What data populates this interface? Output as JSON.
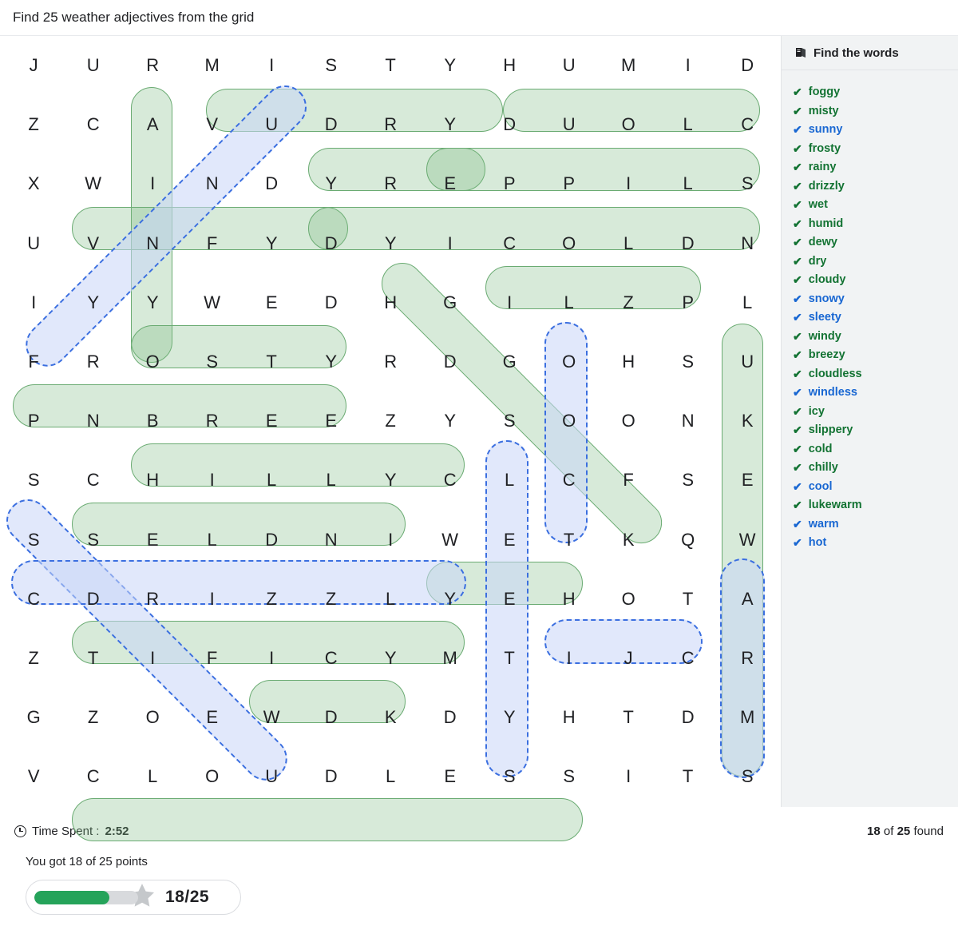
{
  "title": "Find 25 weather adjectives from the grid",
  "grid": {
    "rows": 13,
    "cols": 13,
    "letters": [
      [
        "J",
        "U",
        "R",
        "M",
        "I",
        "S",
        "T",
        "Y",
        "H",
        "U",
        "M",
        "I",
        "D"
      ],
      [
        "Z",
        "C",
        "A",
        "V",
        "U",
        "D",
        "R",
        "Y",
        "D",
        "U",
        "O",
        "L",
        "C"
      ],
      [
        "X",
        "W",
        "I",
        "N",
        "D",
        "Y",
        "R",
        "E",
        "P",
        "P",
        "I",
        "L",
        "S"
      ],
      [
        "U",
        "V",
        "N",
        "F",
        "Y",
        "D",
        "Y",
        "I",
        "C",
        "O",
        "L",
        "D",
        "N"
      ],
      [
        "I",
        "Y",
        "Y",
        "W",
        "E",
        "D",
        "H",
        "G",
        "I",
        "L",
        "Z",
        "P",
        "L"
      ],
      [
        "F",
        "R",
        "O",
        "S",
        "T",
        "Y",
        "R",
        "D",
        "G",
        "O",
        "H",
        "S",
        "U"
      ],
      [
        "P",
        "N",
        "B",
        "R",
        "E",
        "E",
        "Z",
        "Y",
        "S",
        "O",
        "O",
        "N",
        "K"
      ],
      [
        "S",
        "C",
        "H",
        "I",
        "L",
        "L",
        "Y",
        "C",
        "L",
        "C",
        "F",
        "S",
        "E"
      ],
      [
        "S",
        "S",
        "E",
        "L",
        "D",
        "N",
        "I",
        "W",
        "E",
        "T",
        "K",
        "Q",
        "W"
      ],
      [
        "C",
        "D",
        "R",
        "I",
        "Z",
        "Z",
        "L",
        "Y",
        "E",
        "H",
        "O",
        "T",
        "A"
      ],
      [
        "Z",
        "T",
        "I",
        "F",
        "I",
        "C",
        "Y",
        "M",
        "T",
        "I",
        "J",
        "C",
        "R"
      ],
      [
        "G",
        "Z",
        "O",
        "E",
        "W",
        "D",
        "K",
        "D",
        "Y",
        "H",
        "T",
        "D",
        "M"
      ],
      [
        "V",
        "C",
        "L",
        "O",
        "U",
        "D",
        "L",
        "E",
        "S",
        "S",
        "I",
        "T",
        "S"
      ]
    ]
  },
  "sidebar": {
    "header": "Find the words",
    "header_icon": "book-icon",
    "tick_icon": "check-icon",
    "words": [
      {
        "label": "foggy",
        "color": "green"
      },
      {
        "label": "misty",
        "color": "green"
      },
      {
        "label": "sunny",
        "color": "blue"
      },
      {
        "label": "frosty",
        "color": "green"
      },
      {
        "label": "rainy",
        "color": "green"
      },
      {
        "label": "drizzly",
        "color": "green"
      },
      {
        "label": "wet",
        "color": "green"
      },
      {
        "label": "humid",
        "color": "green"
      },
      {
        "label": "dewy",
        "color": "green"
      },
      {
        "label": "dry",
        "color": "green"
      },
      {
        "label": "cloudy",
        "color": "green"
      },
      {
        "label": "snowy",
        "color": "blue"
      },
      {
        "label": "sleety",
        "color": "blue"
      },
      {
        "label": "windy",
        "color": "green"
      },
      {
        "label": "breezy",
        "color": "green"
      },
      {
        "label": "cloudless",
        "color": "green"
      },
      {
        "label": "windless",
        "color": "blue"
      },
      {
        "label": "icy",
        "color": "green"
      },
      {
        "label": "slippery",
        "color": "green"
      },
      {
        "label": "cold",
        "color": "green"
      },
      {
        "label": "chilly",
        "color": "green"
      },
      {
        "label": "cool",
        "color": "blue"
      },
      {
        "label": "lukewarm",
        "color": "green"
      },
      {
        "label": "warm",
        "color": "blue"
      },
      {
        "label": "hot",
        "color": "blue"
      }
    ]
  },
  "footer": {
    "time_icon": "clock-icon",
    "time_label": "Time Spent :",
    "time_value": "2:52",
    "found_value": "18",
    "found_mid": "of",
    "found_total": "25",
    "found_suffix": "found"
  },
  "score": {
    "text": "You got 18 of 25 points",
    "value": "18/25",
    "percent": 72,
    "star_icon": "star-icon",
    "bar_color": "#25a35a"
  },
  "colors": {
    "found_green": "#137333",
    "found_blue": "#1967d2",
    "highlight_green_fill": "#7cba82",
    "highlight_blue_fill": "#c8d6f8",
    "highlight_blue_border": "#3b6fe0"
  }
}
